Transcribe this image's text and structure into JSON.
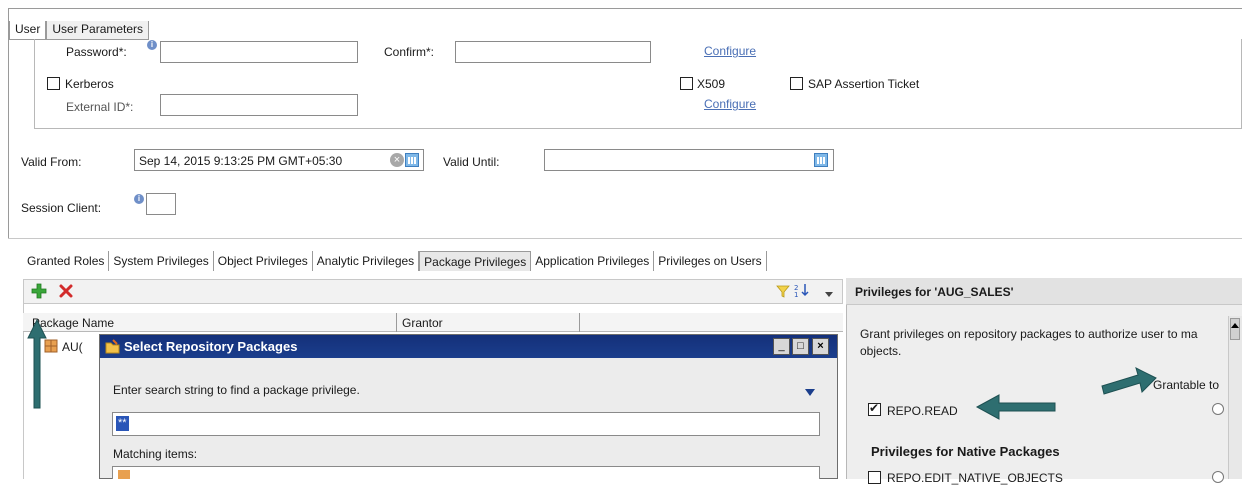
{
  "top_tabs": [
    "User",
    "User Parameters"
  ],
  "auth": {
    "password_label": "Password*:",
    "confirm_label": "Confirm*:",
    "configure_link_1": "Configure",
    "kerberos_label": "Kerberos",
    "external_id_label": "External ID*:",
    "x509_label": "X509",
    "configure_link_2": "Configure",
    "saml_label": "SAP Assertion Ticket"
  },
  "validity": {
    "valid_from_label": "Valid From:",
    "valid_from_value": "Sep 14, 2015 9:13:25 PM GMT+05:30",
    "valid_until_label": "Valid Until:",
    "session_client_label": "Session Client:"
  },
  "privilege_tabs": [
    "Granted Roles",
    "System Privileges",
    "Object Privileges",
    "Analytic Privileges",
    "Package Privileges",
    "Application Privileges",
    "Privileges on Users"
  ],
  "grid": {
    "col_package_name": "Package Name",
    "col_grantor": "Grantor",
    "row_1_partial": "AU("
  },
  "right_panel": {
    "header": "Privileges for 'AUG_SALES'",
    "description_line1": "Grant privileges on repository packages to authorize user to ma",
    "description_line2": "objects.",
    "grantable_to": "Grantable to",
    "repo_read": "REPO.READ",
    "native_heading": "Privileges for Native Packages",
    "repo_edit_native": "REPO.EDIT_NATIVE_OBJECTS"
  },
  "dialog": {
    "title": "Select Repository Packages",
    "prompt": "Enter search string to find a package privilege.",
    "search_value": "**",
    "matching_label": "Matching items:"
  },
  "colors": {
    "dialog_title_bg": "#1b3e8c",
    "arrow_teal": "#2e6e70",
    "link_blue": "#4a6fb5",
    "add_green": "#3aa63a",
    "delete_red": "#d22b2b"
  }
}
